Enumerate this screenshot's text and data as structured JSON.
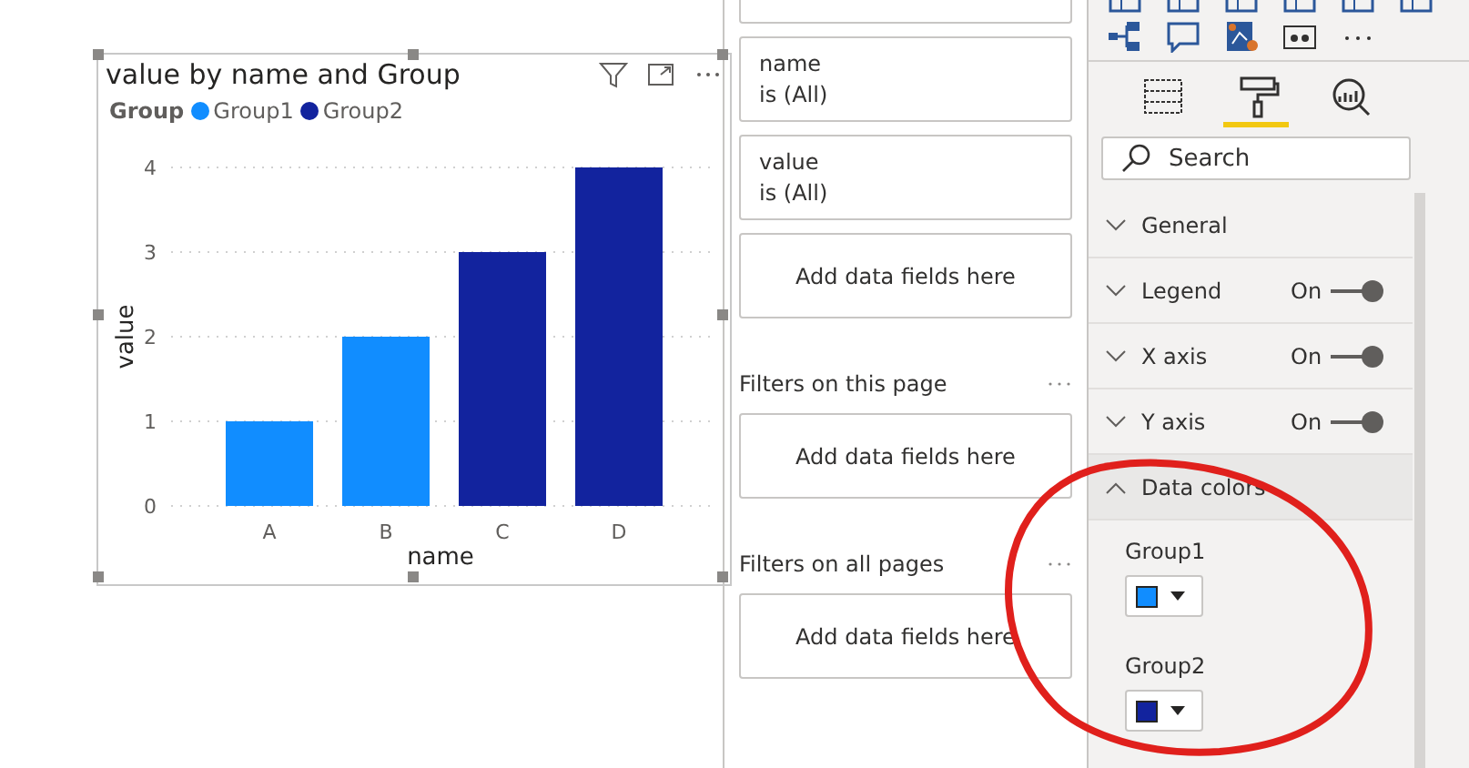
{
  "visual": {
    "title": "value by name and Group",
    "legend": {
      "title": "Group"
    },
    "chart_data": {
      "type": "bar",
      "grid": true,
      "xlabel": "name",
      "ylabel": "value",
      "categories": [
        "A",
        "B",
        "C",
        "D"
      ],
      "stacked": true,
      "ylim": [
        0,
        4
      ],
      "yticks": [
        0,
        1,
        2,
        3,
        4
      ],
      "series": [
        {
          "name": "Group1",
          "color": "#118dff",
          "values": [
            1,
            2,
            null,
            null
          ]
        },
        {
          "name": "Group2",
          "color": "#12239e",
          "values": [
            null,
            null,
            3,
            4
          ]
        }
      ]
    }
  },
  "filters": {
    "visual_filters": [
      {
        "field": "name",
        "condition": "is (All)"
      },
      {
        "field": "value",
        "condition": "is (All)"
      }
    ],
    "visual_drop": "Add data fields here",
    "sections": [
      {
        "title": "Filters on this page",
        "drop": "Add data fields here"
      },
      {
        "title": "Filters on all pages",
        "drop": "Add data fields here"
      }
    ]
  },
  "visualizations": {
    "tabs": [
      {
        "kind": "fields",
        "selected": false
      },
      {
        "kind": "format",
        "selected": true
      },
      {
        "kind": "analytics",
        "selected": false
      }
    ],
    "search": {
      "placeholder": "Search"
    },
    "format_sections": [
      {
        "label": "General",
        "expanded": false
      },
      {
        "label": "Legend",
        "expanded": false,
        "toggle": {
          "label": "On",
          "on": true
        }
      },
      {
        "label": "X axis",
        "expanded": false,
        "toggle": {
          "label": "On",
          "on": true
        }
      },
      {
        "label": "Y axis",
        "expanded": false,
        "toggle": {
          "label": "On",
          "on": true
        }
      },
      {
        "label": "Data colors",
        "expanded": true,
        "colors": [
          {
            "label": "Group1",
            "color": "#118dff"
          },
          {
            "label": "Group2",
            "color": "#12239e"
          }
        ]
      }
    ]
  }
}
